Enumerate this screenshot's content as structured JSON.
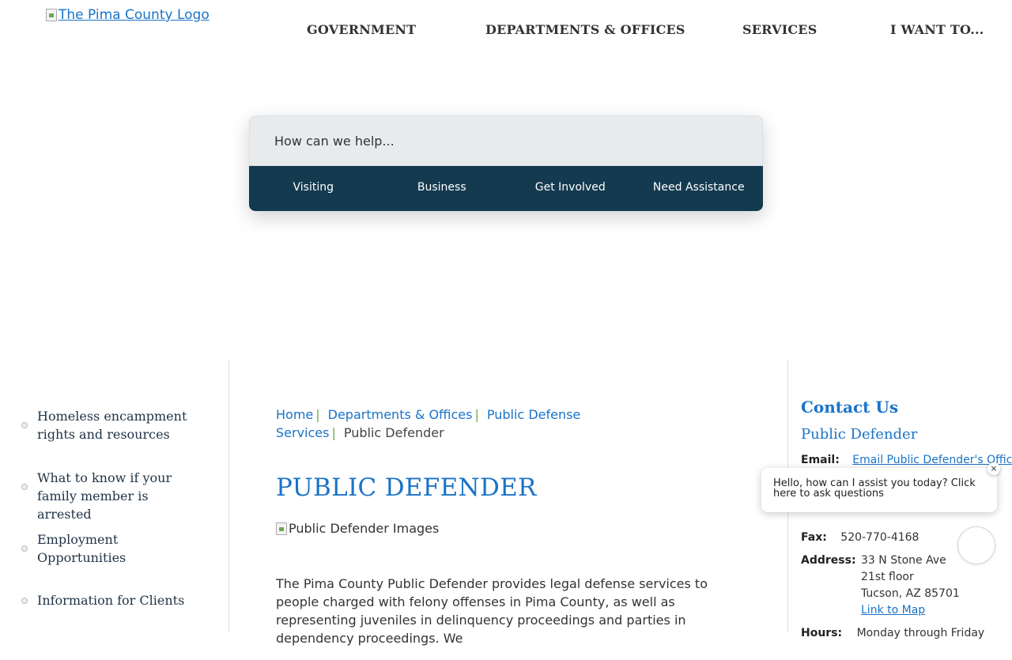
{
  "header": {
    "logo_alt": "The Pima County Logo",
    "nav": [
      {
        "label": "GOVERNMENT"
      },
      {
        "label": "DEPARTMENTS & OFFICES"
      },
      {
        "label": "SERVICES"
      },
      {
        "label": "I WANT TO..."
      }
    ]
  },
  "search": {
    "placeholder": "How can we help...",
    "quick_links": [
      {
        "label": "Visiting"
      },
      {
        "label": "Business"
      },
      {
        "label": "Get Involved"
      },
      {
        "label": "Need Assistance"
      }
    ]
  },
  "sidebar": {
    "items": [
      {
        "label": "Homeless encampment rights and resources"
      },
      {
        "label": "What to know if your family member is arrested"
      },
      {
        "label": "Employment Opportunities"
      },
      {
        "label": "Information for Clients"
      }
    ]
  },
  "breadcrumb": {
    "items": [
      {
        "label": "Home"
      },
      {
        "label": "Departments & Offices"
      },
      {
        "label": "Public Defense Services"
      }
    ],
    "current": "Public Defender"
  },
  "main": {
    "title": "PUBLIC DEFENDER",
    "image_alt": "Public Defender Images",
    "intro": "The Pima County Public Defender provides legal defense services to people charged with felony offenses in Pima County, as well as representing juveniles in delinquency proceedings and parties in dependency proceedings. We"
  },
  "contact": {
    "heading": "Contact Us",
    "office": "Public Defender",
    "email_label": "Email:",
    "email_link": "Email Public Defender's Office",
    "fax_label": "Fax:",
    "fax": "520-770-4168",
    "address_label": "Address:",
    "address_line1": "33 N Stone Ave",
    "address_line2": "21st floor",
    "address_line3": "Tucson, AZ 85701",
    "map_link": "Link to Map",
    "hours_label": "Hours:",
    "hours": "Monday through Friday"
  },
  "chat": {
    "message": "Hello, how can I assist you today? Click here to ask questions",
    "close_symbol": "×"
  },
  "colors": {
    "link_blue": "#1a73c8",
    "nav_dark": "#143a50",
    "separator_green": "#6aa84f"
  }
}
